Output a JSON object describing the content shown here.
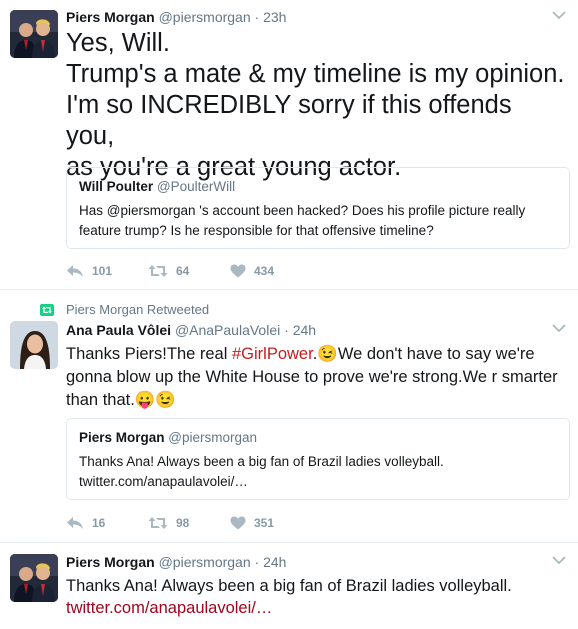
{
  "tweets": [
    {
      "author": {
        "name": "Piers Morgan",
        "handle": "@piersmorgan",
        "separator": "·",
        "time": "23h"
      },
      "text_lines": [
        "Yes, Will.",
        "Trump's a mate & my timeline is my opinion.",
        "I'm so INCREDIBLY sorry if this offends you,",
        "as you're a great young actor."
      ],
      "quote": {
        "name": "Will Poulter",
        "handle": "@PoulterWill",
        "text": "Has @piersmorgan 's account been hacked? Does his profile picture really feature trump? Is he responsible for that offensive timeline?"
      },
      "actions": {
        "replies": "101",
        "retweets": "64",
        "likes": "434"
      }
    },
    {
      "context": "Piers Morgan Retweeted",
      "author": {
        "name": "Ana Paula Vôlei",
        "handle": "@AnaPaulaVolei",
        "separator": "·",
        "time": "24h"
      },
      "text": {
        "part1": "Thanks Piers!The real ",
        "hashtag": "#GirlPower",
        "part2": ".",
        "emoji_wink": "😉",
        "part3": "We don't have to say we're gonna blow up the White House to prove we're strong.We r smarter than that.",
        "emoji_tongue": "😛",
        "emoji_wink2": "😉"
      },
      "quote": {
        "name": "Piers Morgan",
        "handle": "@piersmorgan",
        "text_line1": "Thanks Ana! Always been a big fan of Brazil ladies volleyball.",
        "text_line2": "twitter.com/anapaulavolei/…"
      },
      "actions": {
        "replies": "16",
        "retweets": "98",
        "likes": "351"
      }
    },
    {
      "author": {
        "name": "Piers Morgan",
        "handle": "@piersmorgan",
        "separator": "·",
        "time": "24h"
      },
      "text_line1": "Thanks Ana! Always been a big fan of Brazil ladies volleyball.",
      "link": "twitter.com/anapaulavolei/…"
    }
  ],
  "colors": {
    "link": "#a0041e",
    "hashtag": "#c12020",
    "muted": "#657786",
    "retweet_green": "#19cf86"
  },
  "icons": [
    "chevron-down-icon",
    "reply-icon",
    "retweet-icon",
    "heart-icon"
  ]
}
